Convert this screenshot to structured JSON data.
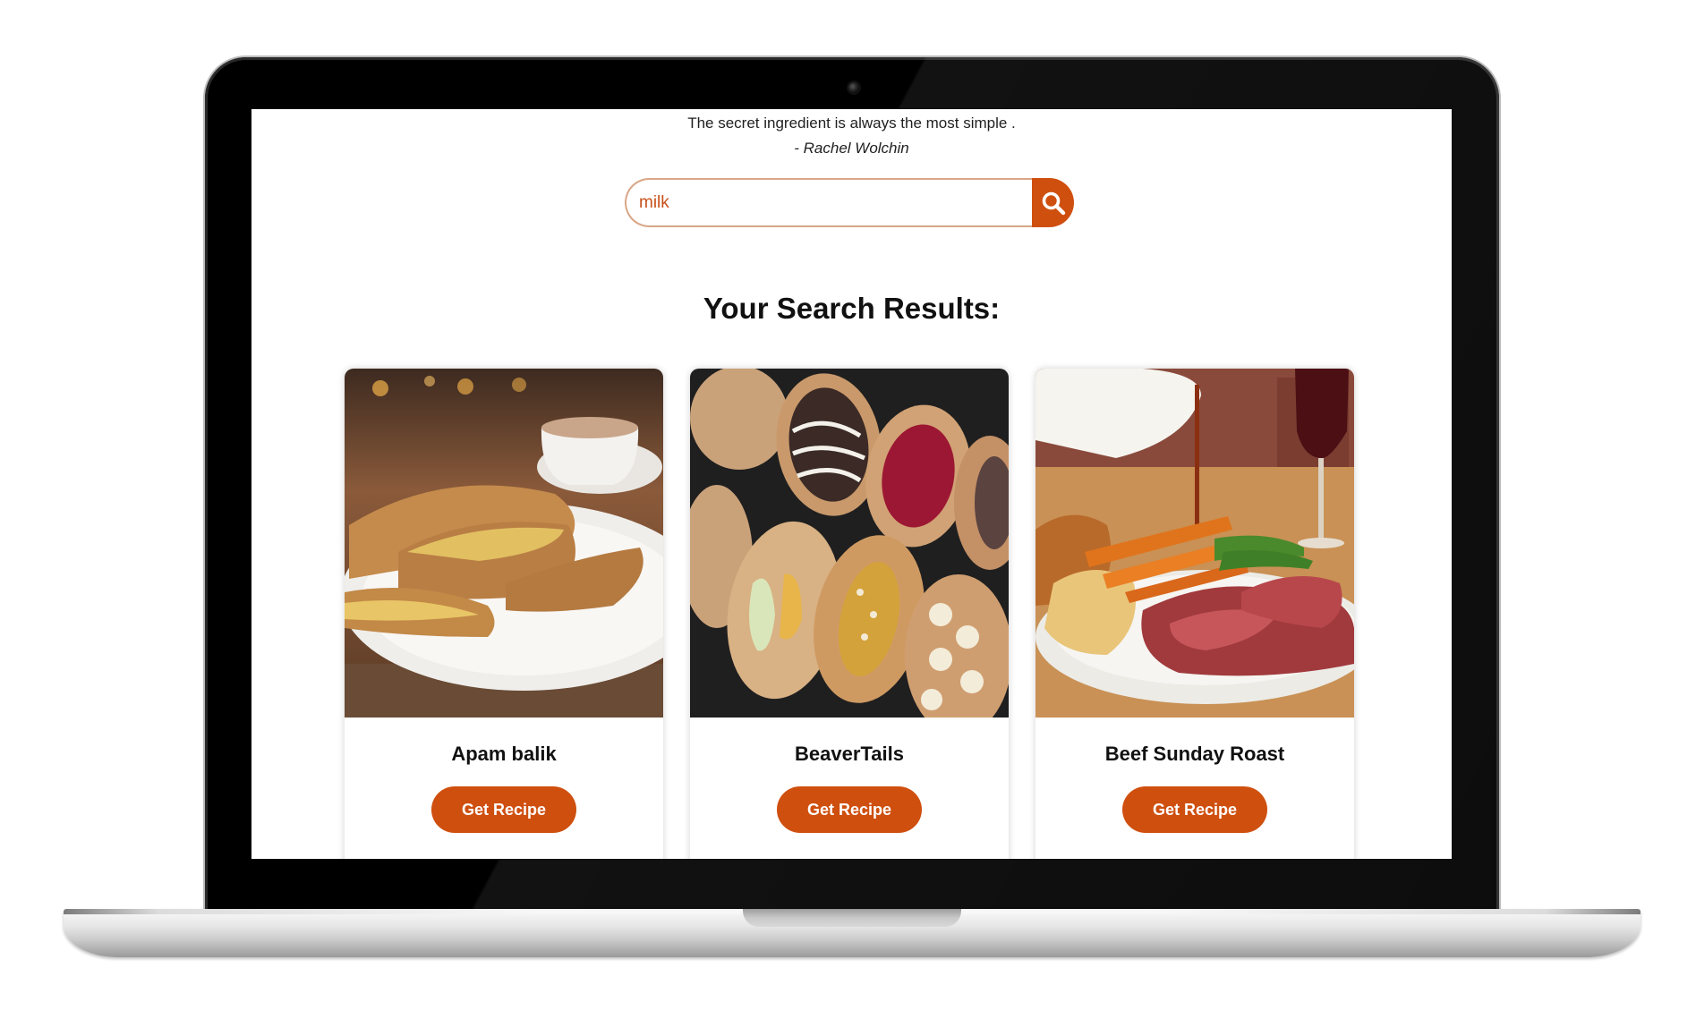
{
  "quote": {
    "text": "The secret ingredient is always the most simple .",
    "author": "- Rachel Wolchin"
  },
  "search": {
    "value": "milk",
    "button_icon": "search-icon"
  },
  "results": {
    "title": "Your Search Results:",
    "cards": [
      {
        "name": "Apam balik",
        "button_label": "Get Recipe",
        "image": "apam-balik-photo"
      },
      {
        "name": "BeaverTails",
        "button_label": "Get Recipe",
        "image": "beavertails-photo"
      },
      {
        "name": "Beef Sunday Roast",
        "button_label": "Get Recipe",
        "image": "beef-sunday-roast-photo"
      }
    ]
  },
  "colors": {
    "accent": "#cf4f0f",
    "input_border": "#d9a686",
    "input_text": "#c8501a",
    "text": "#111111"
  }
}
